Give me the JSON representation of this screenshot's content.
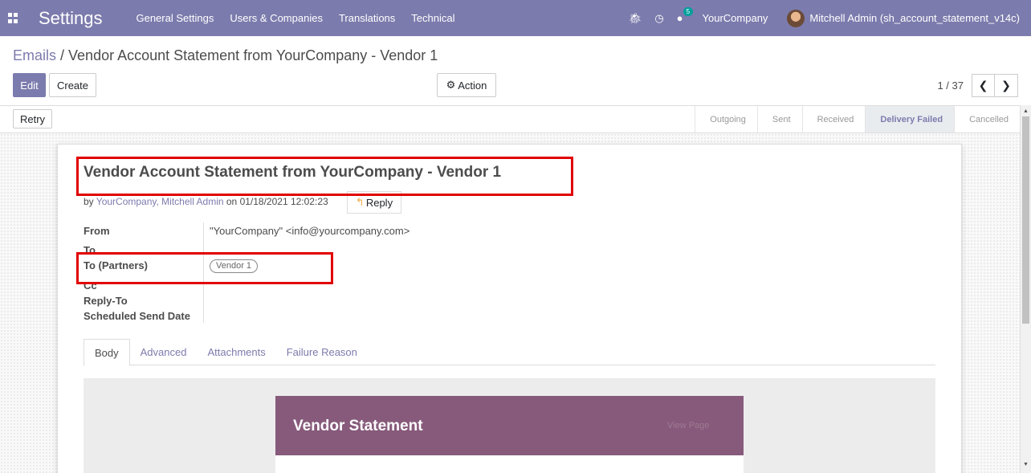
{
  "navbar": {
    "app_title": "Settings",
    "menu": [
      "General Settings",
      "Users & Companies",
      "Translations",
      "Technical"
    ],
    "bug_icon": "bug-icon",
    "clock_icon": "clock-icon",
    "chat_icon": "chat-icon",
    "chat_badge": "5",
    "company": "YourCompany",
    "user": "Mitchell Admin (sh_account_statement_v14c)"
  },
  "breadcrumb": {
    "parent": "Emails",
    "separator": " / ",
    "current": "Vendor Account Statement from YourCompany - Vendor 1"
  },
  "toolbar": {
    "edit_label": "Edit",
    "create_label": "Create",
    "action_label": "Action",
    "action_icon": "gear-icon",
    "pager_value": "1 / 37",
    "prev_icon": "chevron-left-icon",
    "next_icon": "chevron-right-icon"
  },
  "statusbar": {
    "retry_label": "Retry",
    "stages": [
      "Outgoing",
      "Sent",
      "Received",
      "Delivery Failed",
      "Cancelled"
    ],
    "active_stage": "Delivery Failed"
  },
  "message": {
    "subject": "Vendor Account Statement from YourCompany - Vendor 1",
    "by_prefix": "by ",
    "author": "YourCompany, Mitchell Admin",
    "date_text": " on 01/18/2021 12:02:23",
    "reply_label": "Reply"
  },
  "fields": {
    "from_label": "From",
    "from_value": "\"YourCompany\" <info@yourcompany.com>",
    "to_label": "To",
    "to_partners_label": "To (Partners)",
    "to_partners_tag": "Vendor 1",
    "cc_label": "Cc",
    "reply_to_label": "Reply-To",
    "scheduled_label": "Scheduled Send Date"
  },
  "tabs": [
    "Body",
    "Advanced",
    "Attachments",
    "Failure Reason"
  ],
  "body_preview": {
    "title": "Vendor Statement",
    "link": "View Page"
  },
  "colors": {
    "navbar": "#7c7bad",
    "mail_header": "#875a7b",
    "highlight": "#e00000"
  }
}
